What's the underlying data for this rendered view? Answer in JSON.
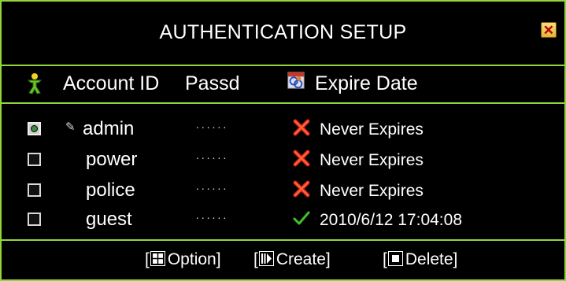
{
  "window": {
    "title": "AUTHENTICATION SETUP",
    "close_icon": "close-icon"
  },
  "columns": {
    "account_id": "Account ID",
    "password": "Passd",
    "expire_date": "Expire Date",
    "account_icon": "person-icon",
    "expire_icon": "calendar-icon"
  },
  "accounts": [
    {
      "checked": true,
      "has_key": true,
      "account_id": "admin",
      "password": "∙∙∙∙∙∙",
      "expire_status": "x-icon",
      "expire": "Never Expires"
    },
    {
      "checked": false,
      "has_key": false,
      "account_id": "power",
      "password": "∙∙∙∙∙∙",
      "expire_status": "x-icon",
      "expire": "Never Expires"
    },
    {
      "checked": false,
      "has_key": false,
      "account_id": "police",
      "password": "∙∙∙∙∙∙",
      "expire_status": "x-icon",
      "expire": "Never Expires"
    },
    {
      "checked": false,
      "has_key": false,
      "account_id": "guest",
      "password": "∙∙∙∙∙∙",
      "expire_status": "check-icon",
      "expire": "2010/6/12 17:04:08"
    }
  ],
  "footer": {
    "option_label": "Option]",
    "create_label": "Create]",
    "delete_label": "Delete]",
    "open_bracket": "["
  },
  "colors": {
    "accent": "#8fd63a",
    "background": "#000000",
    "text": "#ffffff",
    "never_expire_x": "#e0281a",
    "expire_check": "#3fc22c"
  }
}
